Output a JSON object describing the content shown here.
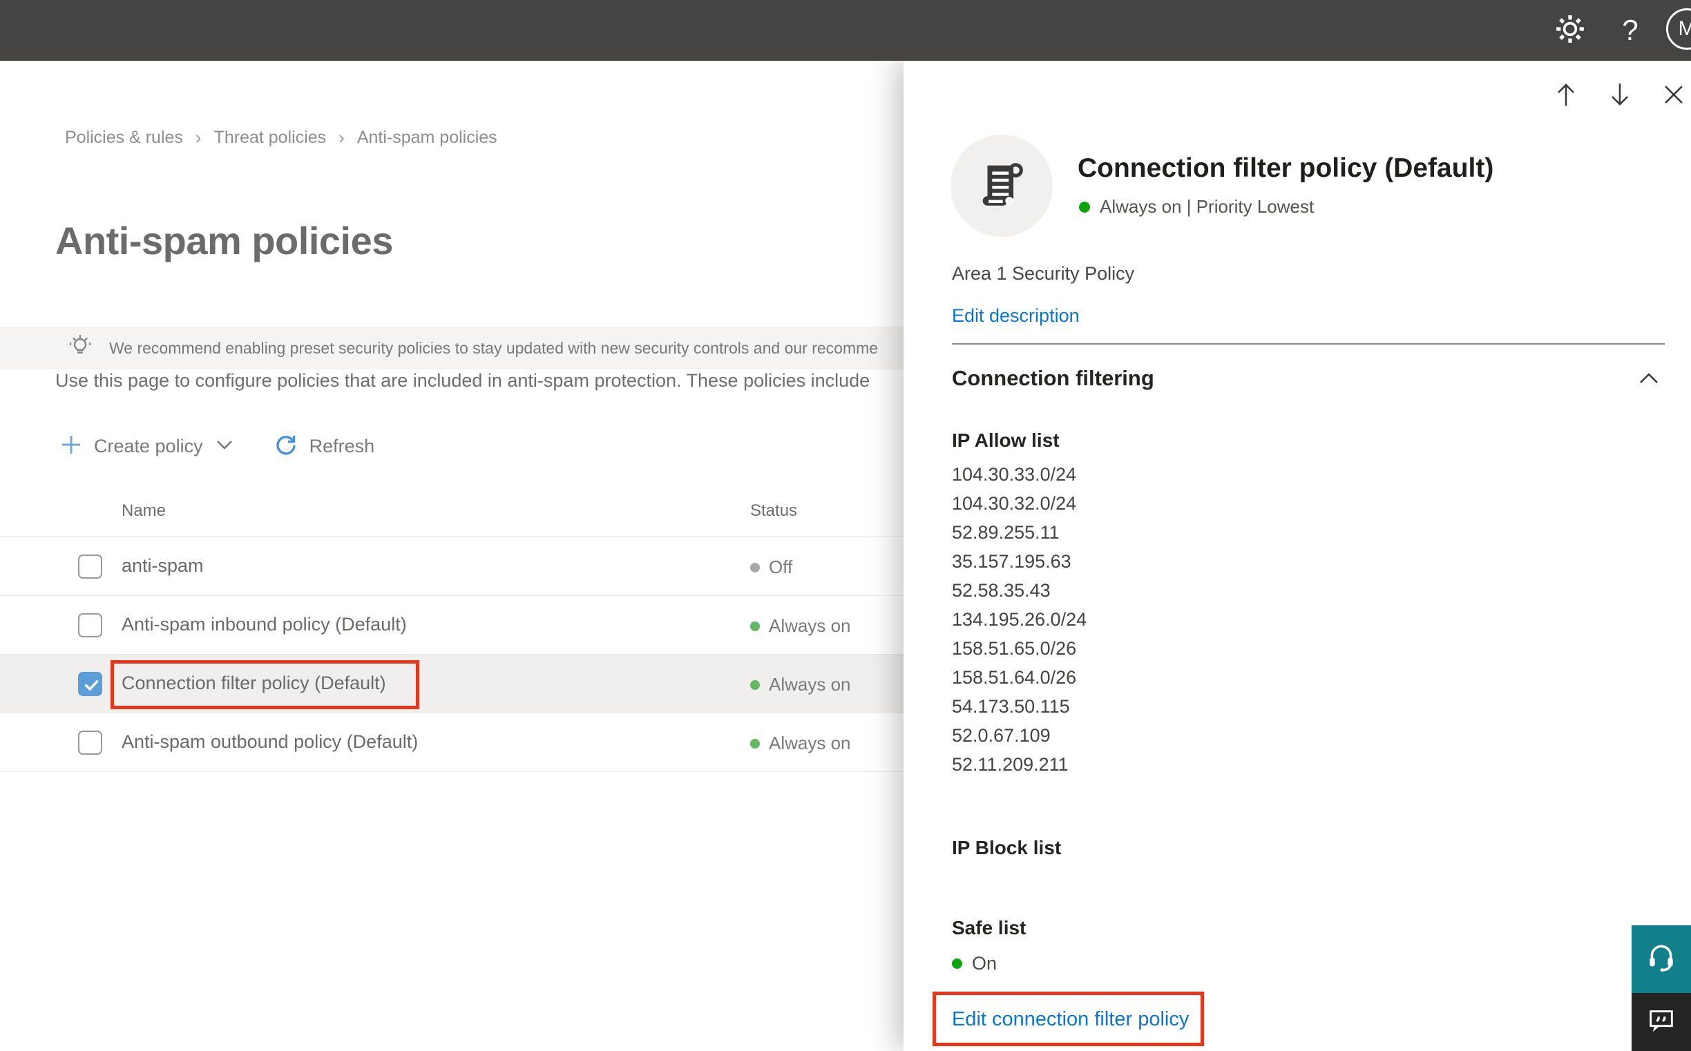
{
  "topbar": {
    "avatar_initial": "M"
  },
  "breadcrumb": {
    "items": [
      "Policies & rules",
      "Threat policies",
      "Anti-spam policies"
    ]
  },
  "page": {
    "title": "Anti-spam policies",
    "banner_text": "We recommend enabling preset security policies to stay updated with new security controls and our recomme",
    "description": "Use this page to configure policies that are included in anti-spam protection. These policies include"
  },
  "toolbar": {
    "create_policy_label": "Create policy",
    "refresh_label": "Refresh"
  },
  "table": {
    "columns": [
      "Name",
      "Status"
    ],
    "rows": [
      {
        "name": "anti-spam",
        "status": "Off",
        "status_color": "#a8a8a8",
        "checked": false,
        "selected": false,
        "annotated": false
      },
      {
        "name": "Anti-spam inbound policy (Default)",
        "status": "Always on",
        "status_color": "#63b963",
        "checked": false,
        "selected": false,
        "annotated": false
      },
      {
        "name": "Connection filter policy (Default)",
        "status": "Always on",
        "status_color": "#63b963",
        "checked": true,
        "selected": true,
        "annotated": true
      },
      {
        "name": "Anti-spam outbound policy (Default)",
        "status": "Always on",
        "status_color": "#63b963",
        "checked": false,
        "selected": false,
        "annotated": false
      }
    ]
  },
  "flyout": {
    "title": "Connection filter policy (Default)",
    "status_line": "Always on | Priority Lowest",
    "status_color": "#0ea30b",
    "description": "Area 1 Security Policy",
    "edit_description_label": "Edit description",
    "section_title": "Connection filtering",
    "ip_allow": {
      "label": "IP Allow list",
      "ips": [
        "104.30.33.0/24",
        "104.30.32.0/24",
        "52.89.255.11",
        "35.157.195.63",
        "52.58.35.43",
        "134.195.26.0/24",
        "158.51.65.0/26",
        "158.51.64.0/26",
        "54.173.50.115",
        "52.0.67.109",
        "52.11.209.211"
      ]
    },
    "ip_block": {
      "label": "IP Block list"
    },
    "safe_list": {
      "label": "Safe list",
      "value": "On",
      "status_color": "#0ea30b"
    },
    "edit_link_label": "Edit connection filter policy"
  },
  "colors": {
    "annotation_red": "#e5371c",
    "accent_blue": "#0b76cf",
    "checkbox_blue": "#5c9fd8",
    "topbar_gray": "#454442",
    "support_teal": "#12808a"
  }
}
